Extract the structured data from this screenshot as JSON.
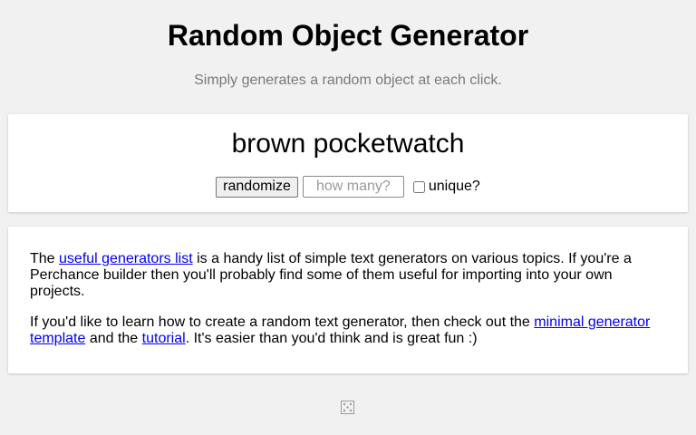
{
  "header": {
    "title": "Random Object Generator",
    "subtitle": "Simply generates a random object at each click."
  },
  "generator": {
    "result": "brown pocketwatch",
    "randomize_label": "randomize",
    "how_many_placeholder": "how many?",
    "how_many_value": "",
    "unique_label": "unique?",
    "unique_checked": false
  },
  "info": {
    "p1": {
      "before": "The ",
      "link": "useful generators list",
      "after": " is a handy list of simple text generators on various topics. If you're a Perchance builder then you'll probably find some of them useful for importing into your own projects."
    },
    "p2": {
      "before": "If you'd like to learn how to create a random text generator, then check out the ",
      "link1": "minimal generator template",
      "middle": " and the ",
      "link2": "tutorial",
      "after": ". It's easier than you'd think and is great fun :)"
    }
  },
  "footer": {
    "icon": "dice-icon"
  },
  "colors": {
    "background": "#f1f1f1",
    "card": "#ffffff",
    "subtitle": "#7a7a7a",
    "link": "#0000ee"
  }
}
